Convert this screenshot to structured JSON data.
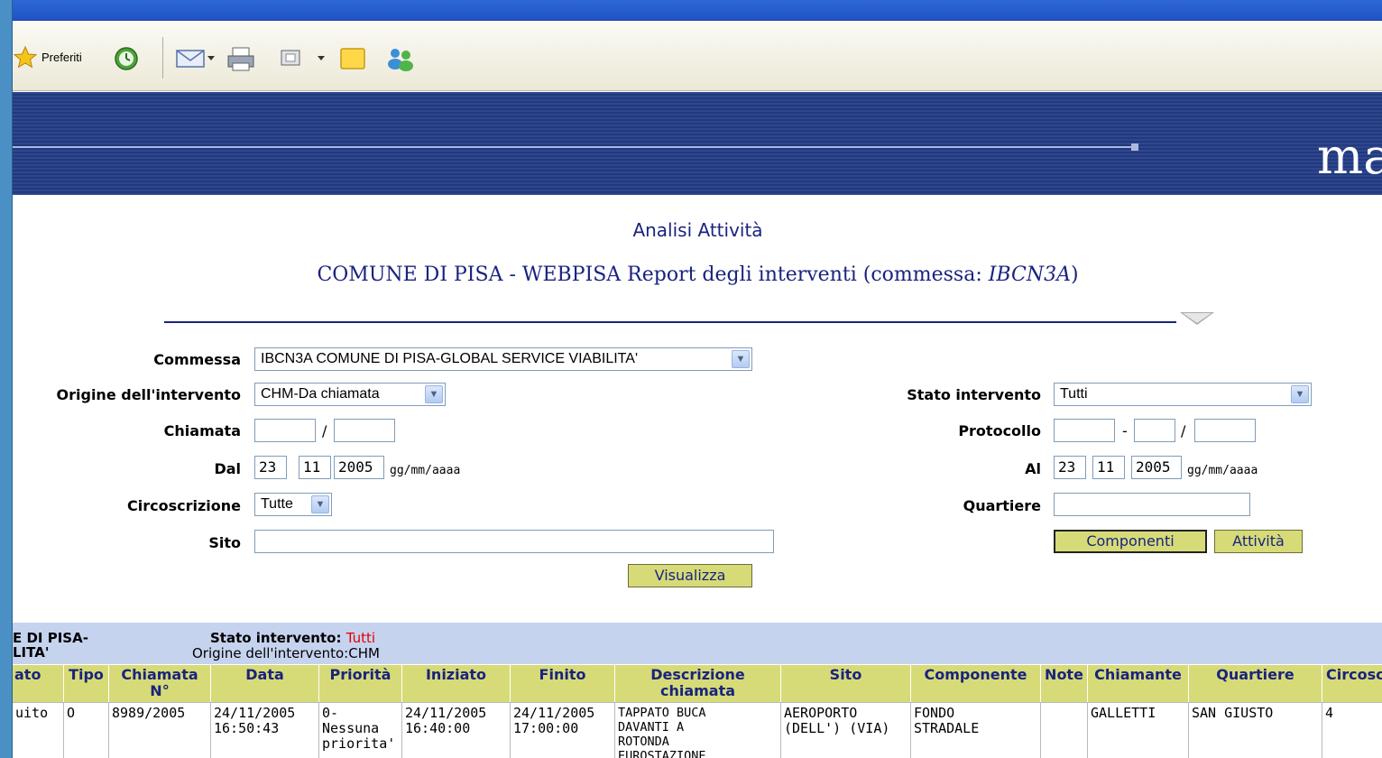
{
  "toolbar": {
    "favorites_label": "Preferiti"
  },
  "banner": {
    "logo_text": "ma"
  },
  "page": {
    "title": "Analisi Attività",
    "subtitle_prefix": "COMUNE DI PISA - WEBPISA Report degli interventi (commessa: ",
    "subtitle_commessa": "IBCN3A",
    "subtitle_suffix": ")"
  },
  "form": {
    "commessa": {
      "label": "Commessa",
      "value": "IBCN3A COMUNE DI PISA-GLOBAL SERVICE VIABILITA'"
    },
    "origine": {
      "label": "Origine dell'intervento",
      "value": "CHM-Da chiamata"
    },
    "stato": {
      "label": "Stato intervento",
      "value": "Tutti"
    },
    "chiamata": {
      "label": "Chiamata",
      "sep": "/",
      "num": "",
      "year": ""
    },
    "protocollo": {
      "label": "Protocollo",
      "sep1": "-",
      "sep2": "/",
      "a": "",
      "b": "",
      "c": ""
    },
    "dal": {
      "label": "Dal",
      "dd": "23",
      "mm": "11",
      "yyyy": "2005",
      "format": "gg/mm/aaaa"
    },
    "al": {
      "label": "Al",
      "dd": "23",
      "mm": "11",
      "yyyy": "2005",
      "format": "gg/mm/aaaa"
    },
    "circoscrizione": {
      "label": "Circoscrizione",
      "value": "Tutte"
    },
    "quartiere": {
      "label": "Quartiere",
      "value": ""
    },
    "sito": {
      "label": "Sito",
      "value": ""
    },
    "buttons": {
      "componenti": "Componenti",
      "attivita": "Attività",
      "visualizza": "Visualizza"
    }
  },
  "results": {
    "commessa_line1": "E DI PISA-",
    "commessa_line2": "LITA'",
    "stato_label": "Stato intervento: ",
    "stato_value": "Tutti",
    "origine_text": "Origine dell'intervento:CHM",
    "columns": [
      "ato",
      "Tipo",
      "Chiamata N°",
      "Data",
      "Priorità",
      "Iniziato",
      "Finito",
      "Descrizione chiamata",
      "Sito",
      "Componente",
      "Note",
      "Chiamante",
      "Quartiere",
      "Circosc"
    ],
    "rows": [
      {
        "stato": "uito",
        "tipo": "O",
        "chiamata": "8989/2005",
        "data": "24/11/2005\n16:50:43",
        "priorita": "0-\nNessuna\npriorita'",
        "iniziato": "24/11/2005\n16:40:00",
        "finito": "24/11/2005\n17:00:00",
        "descrizione": "TAPPATO BUCA\nDAVANTI A\nROTONDA\nEUROSTAZIONE",
        "sito": "AEROPORTO\n(DELL') (VIA)",
        "componente": "FONDO\nSTRADALE",
        "note": "",
        "chiamante": "GALLETTI",
        "quartiere": "SAN GIUSTO",
        "circoscrizione": "4"
      }
    ]
  }
}
